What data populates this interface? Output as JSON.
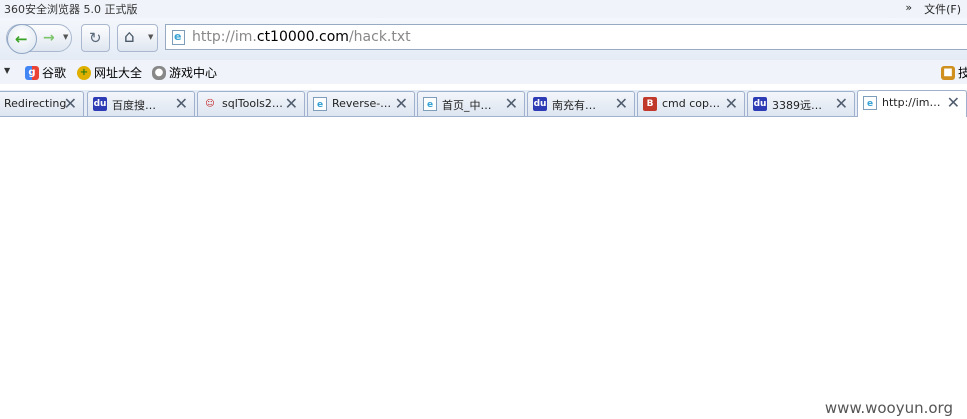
{
  "window": {
    "title": "360安全浏览器 5.0 正式版",
    "more": "»",
    "menu_file": "文件(F)"
  },
  "nav": {
    "back_icon": "left-arrow-icon",
    "forward_icon": "right-arrow-icon",
    "reload_icon": "refresh-icon",
    "home_icon": "home-icon",
    "dropdown_icon": "▼",
    "url_prefix": "http://im.",
    "url_domain": "ct10000.com",
    "url_path": "/hack.txt"
  },
  "bookmarks": {
    "items": [
      {
        "label": "谷歌",
        "icon": "google-icon"
      },
      {
        "label": "网址大全",
        "icon": "web-directory-icon"
      },
      {
        "label": "游戏中心",
        "icon": "gamepad-icon"
      }
    ],
    "right_partial": "技"
  },
  "tabs": [
    {
      "label": "Redirecting",
      "icon": "none"
    },
    {
      "label": "百度搜…",
      "icon": "baidu-icon"
    },
    {
      "label": "sqlTools2…",
      "icon": "person-icon"
    },
    {
      "label": "Reverse-…",
      "icon": "ie-page-icon"
    },
    {
      "label": "首页_中…",
      "icon": "ie-page-icon"
    },
    {
      "label": "南充有…",
      "icon": "baidu-icon"
    },
    {
      "label": "cmd cop…",
      "icon": "b-logo-icon"
    },
    {
      "label": "3389远…",
      "icon": "baidu-icon"
    },
    {
      "label": "http://im…",
      "icon": "ie-page-icon",
      "active": true
    }
  ],
  "watermark": "www.wooyun.org",
  "colors": {
    "accent_green": "#3aa226",
    "baidu_blue": "#2d3bb5",
    "ie_blue": "#37a2d4"
  }
}
